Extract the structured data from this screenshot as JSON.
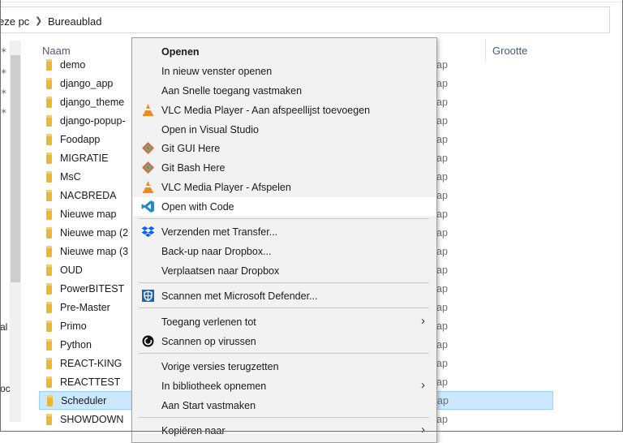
{
  "breadcrumb": {
    "this_pc": "eze pc",
    "desktop": "Bureaublad"
  },
  "nav_fragments": [
    "al",
    "oc"
  ],
  "columns": {
    "name": "Naam",
    "size": "Grootte"
  },
  "files": [
    {
      "name": "demo",
      "type": "ap"
    },
    {
      "name": "django_app",
      "type": "ap"
    },
    {
      "name": "django_theme",
      "type": "ap"
    },
    {
      "name": "django-popup-",
      "type": "ap"
    },
    {
      "name": "Foodapp",
      "type": "ap"
    },
    {
      "name": "MIGRATIE",
      "type": "ap"
    },
    {
      "name": "MsC",
      "type": "ap"
    },
    {
      "name": "NACBREDA",
      "type": "ap"
    },
    {
      "name": "Nieuwe map",
      "type": "ap"
    },
    {
      "name": "Nieuwe map (2",
      "type": "ap"
    },
    {
      "name": "Nieuwe map (3",
      "type": "ap"
    },
    {
      "name": "OUD",
      "type": "ap"
    },
    {
      "name": "PowerBITEST",
      "type": "ap"
    },
    {
      "name": "Pre-Master",
      "type": "ap"
    },
    {
      "name": "Primo",
      "type": "ap"
    },
    {
      "name": "Python",
      "type": "ap"
    },
    {
      "name": "REACT-KING",
      "type": "ap"
    },
    {
      "name": "REACTTEST",
      "type": "ap"
    },
    {
      "name": "Scheduler",
      "type": "ap"
    },
    {
      "name": "SHOWDOWN",
      "type": "ap"
    }
  ],
  "menu": {
    "open": "Openen",
    "open_new_window": "In nieuw venster openen",
    "pin_quick": "Aan Snelle toegang vastmaken",
    "vlc_add": "VLC Media Player - Aan afspeellijst toevoegen",
    "open_vs": "Open in Visual Studio",
    "git_gui": "Git GUI Here",
    "git_bash": "Git Bash Here",
    "vlc_play": "VLC Media Player - Afspelen",
    "open_code": "Open with Code",
    "transfer": "Verzenden met Transfer...",
    "backup_dropbox": "Back-up naar Dropbox...",
    "move_dropbox": "Verplaatsen naar Dropbox",
    "defender": "Scannen met Microsoft Defender...",
    "give_access": "Toegang verlenen tot",
    "scan_virus": "Scannen op virussen",
    "prev_versions": "Vorige versies terugzetten",
    "include_library": "In bibliotheek opnemen",
    "pin_start": "Aan Start vastmaken",
    "copy_to": "Kopiëren naar"
  },
  "colors": {
    "selection": "#cce8ff",
    "menu_bg": "#f2f2f2",
    "folder": "#e8b83a",
    "vscode": "#1f8ad2",
    "vlc": "#f08a1c"
  }
}
